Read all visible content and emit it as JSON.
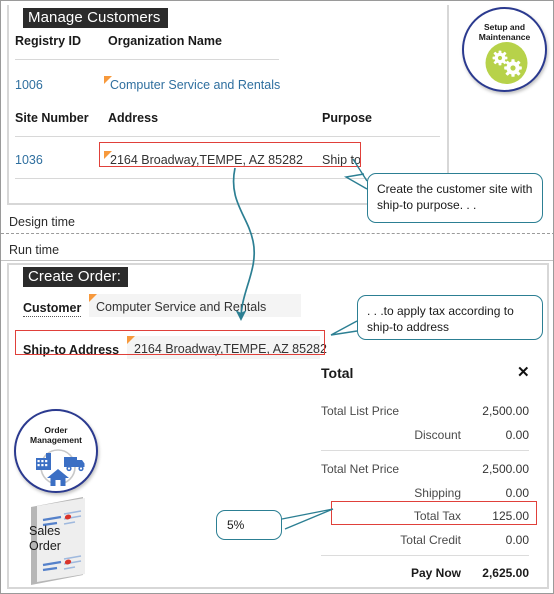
{
  "design_time": {
    "phase_label": "Design time",
    "screen_title": "Manage Customers",
    "columns_top": {
      "registry_id": "Registry ID",
      "organization_name": "Organization Name"
    },
    "row_top": {
      "registry_id": "1006",
      "organization_name": "Computer Service and Rentals"
    },
    "columns_site": {
      "site_number": "Site Number",
      "address": "Address",
      "purpose": "Purpose"
    },
    "row_site": {
      "site_number": "1036",
      "address": "2164 Broadway,TEMPE, AZ 85282",
      "purpose": "Ship to"
    }
  },
  "run_time": {
    "phase_label": "Run time",
    "screen_title": "Create Order:",
    "customer_label": "Customer",
    "customer_value": "Computer Service and Rentals",
    "shipto_label": "Ship-to Address",
    "shipto_value": "2164 Broadway,TEMPE, AZ 85282"
  },
  "total_panel": {
    "title": "Total",
    "close_icon": "close-icon",
    "rows": [
      {
        "label": "Total List Price",
        "value": "2,500.00",
        "bold": false
      },
      {
        "label": "Discount",
        "value": "0.00",
        "bold": false
      },
      {
        "label": "Total Net Price",
        "value": "2,500.00",
        "bold": false
      },
      {
        "label": "Shipping",
        "value": "0.00",
        "bold": false
      },
      {
        "label": "Total Tax",
        "value": "125.00",
        "bold": false
      },
      {
        "label": "Total Credit",
        "value": "0.00",
        "bold": false
      },
      {
        "label": "Pay Now",
        "value": "2,625.00",
        "bold": true
      }
    ]
  },
  "badges": {
    "setup": {
      "line1": "Setup and",
      "line2": "Maintenance",
      "icon": "gears-icon"
    },
    "order_management": {
      "line1": "Order",
      "line2": "Management",
      "icon": "supply-chain-icon"
    }
  },
  "sales_order_doc": {
    "line1": "Sales",
    "line2": "Order"
  },
  "callouts": {
    "create_site": "Create the customer site with ship-to purpose. . .",
    "apply_tax": ". . .to apply tax according to ship-to address",
    "tax_rate": "5%"
  },
  "colors": {
    "link": "#2f6f9f",
    "accent_red": "#e0403a",
    "callout_teal": "#2c7f93",
    "badge_blue": "#2b3a8f",
    "badge_green": "#b7d24a",
    "flag_orange": "#f7993c",
    "title_bg": "#2b2b2b"
  }
}
